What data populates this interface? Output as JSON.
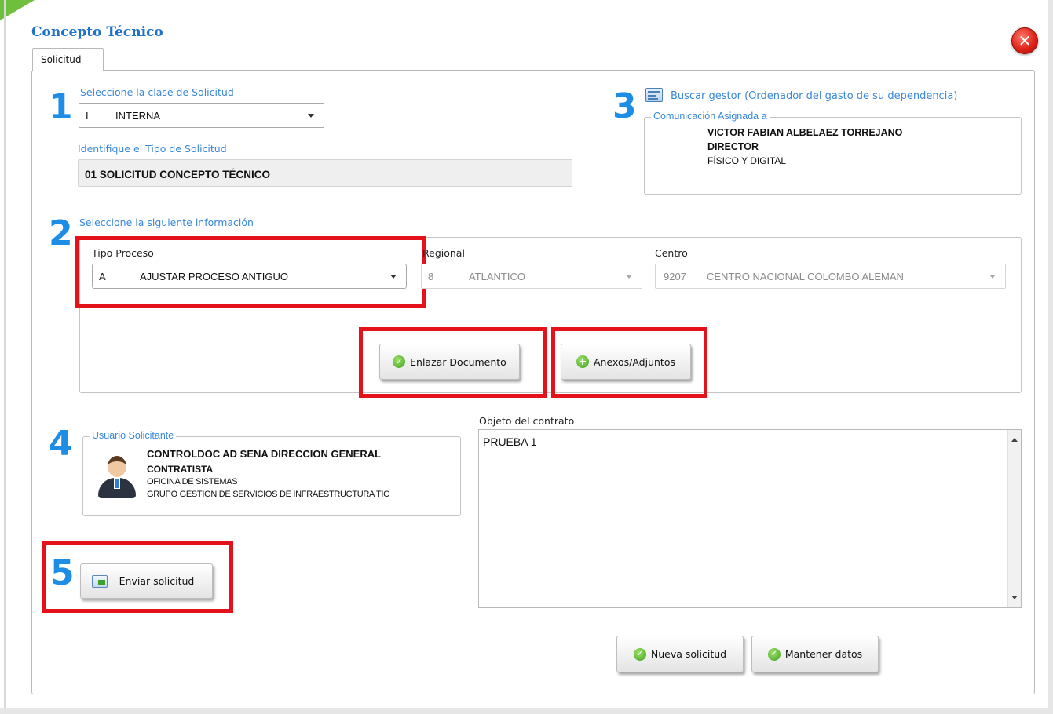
{
  "dialog": {
    "title": "Concepto Técnico",
    "close_glyph": "✕"
  },
  "tabs": [
    {
      "label": "Solicitud",
      "active": true
    }
  ],
  "steps": [
    "1",
    "2",
    "3",
    "4",
    "5"
  ],
  "section1": {
    "class_label": "Seleccione la clase de Solicitud",
    "class_select": {
      "code": "I",
      "text": "INTERNA"
    },
    "type_label": "Identifique el Tipo de Solicitud",
    "type_value": "01 SOLICITUD CONCEPTO TÉCNICO"
  },
  "section2": {
    "label": "Seleccione la siguiente información",
    "tipo_proceso": {
      "label": "Tipo Proceso",
      "code": "A",
      "text": "AJUSTAR PROCESO ANTIGUO"
    },
    "regional": {
      "label": "Regional",
      "code": "8",
      "text": "ATLANTICO"
    },
    "centro": {
      "label": "Centro",
      "code": "9207",
      "text": "CENTRO NACIONAL COLOMBO ALEMAN"
    },
    "buttons": {
      "link_doc": "Enlazar Documento",
      "attachments": "Anexos/Adjuntos"
    }
  },
  "section3": {
    "search_link": "Buscar gestor (Ordenador del gasto de su dependencia)",
    "legend": "Comunicación Asignada a",
    "name": "VICTOR FABIAN  ALBELAEZ TORREJANO",
    "role": "DIRECTOR",
    "mode": "FÍSICO Y DIGITAL"
  },
  "section4": {
    "legend": "Usuario Solicitante",
    "name": "CONTROLDOC AD SENA DIRECCION GENERAL",
    "role": "CONTRATISTA",
    "office": "OFICINA DE SISTEMAS",
    "group": "GRUPO GESTION DE SERVICIOS DE INFRAESTRUCTURA TIC"
  },
  "contract": {
    "label": "Objeto del contrato",
    "value": "PRUEBA 1"
  },
  "section5": {
    "send_button": "Enviar solicitud"
  },
  "footer": {
    "new_request": "Nueva solicitud",
    "keep_data": "Mantener datos"
  },
  "colors": {
    "accent": "#1e73c8",
    "step": "#1e8de6",
    "highlight": "#e3121b",
    "ok": "#3f9f1f"
  }
}
